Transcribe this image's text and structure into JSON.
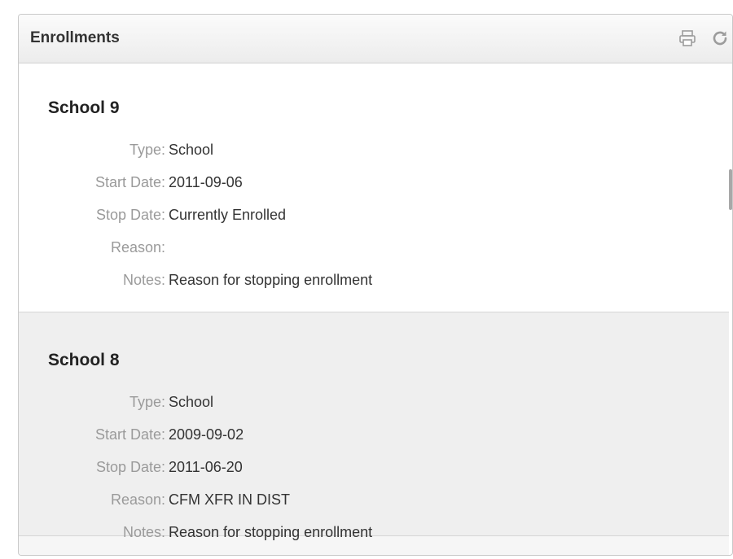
{
  "panel": {
    "title": "Enrollments",
    "icons": [
      "print-icon",
      "refresh-icon"
    ]
  },
  "enrollments": [
    {
      "name": "School 9",
      "fields": [
        {
          "label": "Type:",
          "value": "School"
        },
        {
          "label": "Start Date:",
          "value": "2011-09-06"
        },
        {
          "label": "Stop Date:",
          "value": "Currently Enrolled"
        },
        {
          "label": "Reason:",
          "value": ""
        },
        {
          "label": "Notes:",
          "value": "Reason for stopping enrollment"
        }
      ]
    },
    {
      "name": "School 8",
      "fields": [
        {
          "label": "Type:",
          "value": "School"
        },
        {
          "label": "Start Date:",
          "value": "2009-09-02"
        },
        {
          "label": "Stop Date:",
          "value": "2011-06-20"
        },
        {
          "label": "Reason:",
          "value": "CFM XFR IN DIST"
        },
        {
          "label": "Notes:",
          "value": "Reason for stopping enrollment"
        }
      ]
    }
  ]
}
